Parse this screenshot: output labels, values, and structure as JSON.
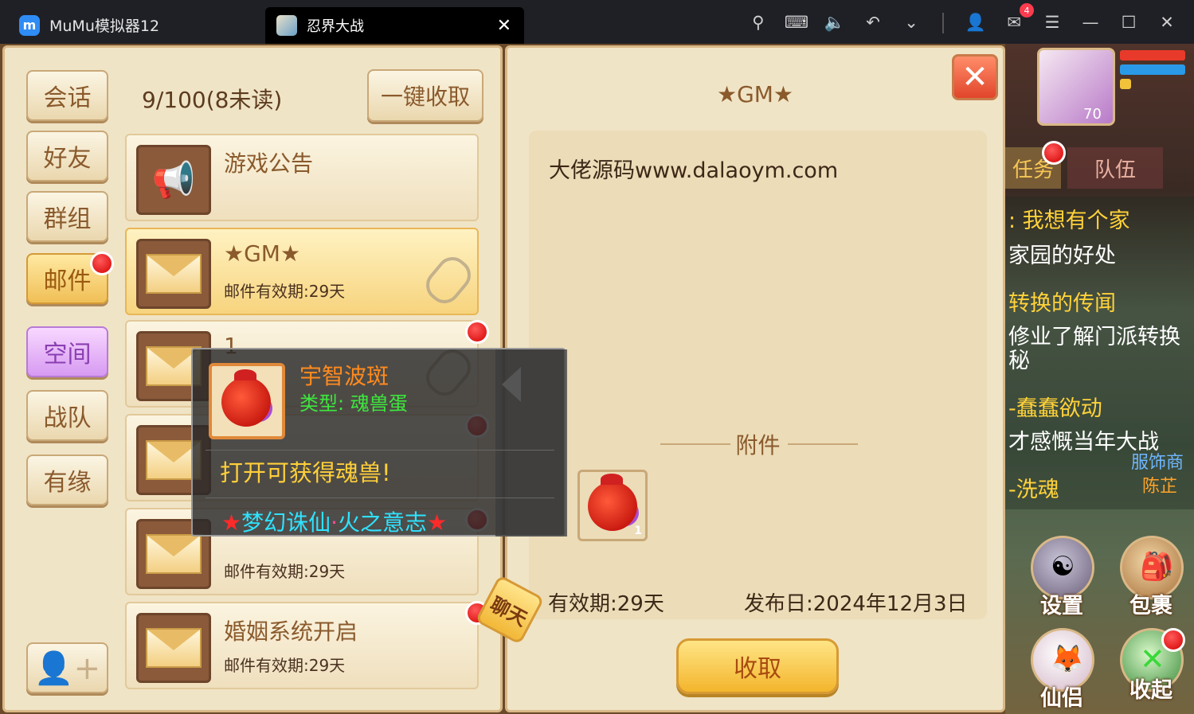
{
  "titlebar": {
    "app_name": "MuMu模拟器12",
    "tab_title": "忍界大战",
    "mail_badge": "4",
    "icons": [
      "pin-icon",
      "keyboard-icon",
      "volume-icon",
      "undo-icon",
      "chevron-down-icon",
      "user-icon",
      "mail-icon",
      "menu-icon",
      "minimize-icon",
      "maximize-icon",
      "close-icon"
    ]
  },
  "sidebar": {
    "items": [
      {
        "label": "会话"
      },
      {
        "label": "好友"
      },
      {
        "label": "群组"
      },
      {
        "label": "邮件"
      },
      {
        "label": "空间"
      },
      {
        "label": "战队"
      },
      {
        "label": "有缘"
      }
    ]
  },
  "mailbox": {
    "count": "9/100(8未读)",
    "collect_all": "一键收取",
    "items": [
      {
        "title": "游戏公告",
        "sub": ""
      },
      {
        "title": "★GM★",
        "sub": "邮件有效期:29天"
      },
      {
        "title": "1",
        "sub": ""
      },
      {
        "title": "",
        "sub": ""
      },
      {
        "title": "",
        "sub": "邮件有效期:29天"
      },
      {
        "title": "婚姻系统开启",
        "sub": "邮件有效期:29天"
      }
    ]
  },
  "tooltip": {
    "name": "宇智波斑",
    "type": "类型: 魂兽蛋",
    "desc": "打开可获得魂兽!",
    "source_star_left": "★",
    "source_part1": "梦幻诛仙",
    "source_dot": "·",
    "source_part2": "火之意志",
    "source_star_right": "★"
  },
  "detail": {
    "title": "★GM★",
    "text": "大佬源码www.dalaoym.com",
    "attach_label": "附件",
    "attach_count": "1",
    "expiry": "有效期:29天",
    "publish": "发布日:2024年12月3日",
    "collect": "收取"
  },
  "chat_tag": "聊天",
  "hud": {
    "level": "70",
    "task_tab": "任务",
    "team_tab": "队伍",
    "quests": [
      {
        "text": ": 我想有个家",
        "style": "y"
      },
      {
        "text": "家园的好处",
        "style": "w"
      },
      {
        "text": "转换的传闻",
        "style": "y"
      },
      {
        "text": "修业了解门派转换",
        "style": "w"
      },
      {
        "text": "秘",
        "style": "w"
      },
      {
        "text": "-蠢蠢欲动",
        "style": "y"
      },
      {
        "text": "才感慨当年大战",
        "style": "w"
      },
      {
        "text": "-洗魂",
        "style": "y"
      }
    ],
    "npc_shop": "服饰商",
    "npc_name": "陈芷",
    "settings": "设置",
    "bag": "包裹",
    "partner": "仙侣",
    "collapse": "收起"
  },
  "colors": {
    "panel_bg": "#f0e4c6",
    "accent_gold": "#f3b52c",
    "red_dot": "#d40000",
    "tooltip_name": "#ff8a1e",
    "tooltip_type": "#3de83d",
    "tooltip_source": "#2ee3ff"
  }
}
